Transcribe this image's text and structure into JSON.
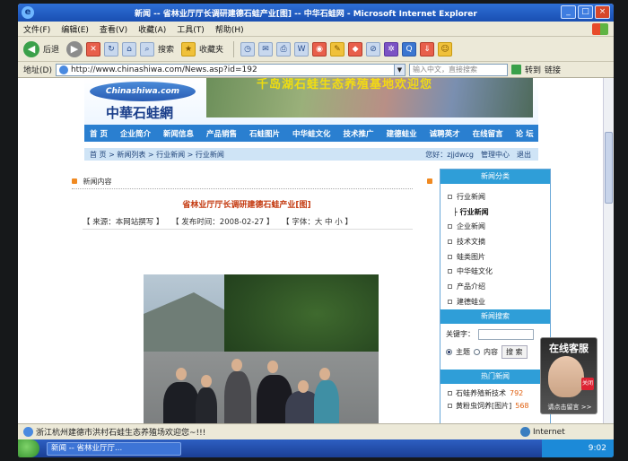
{
  "window": {
    "title": "新闻 -- 省林业厅厅长调研建德石蛙产业[图] -- 中华石蛙网 - Microsoft Internet Explorer",
    "buttons": [
      "_",
      "□",
      "×"
    ]
  },
  "menu": [
    "文件(F)",
    "编辑(E)",
    "查看(V)",
    "收藏(A)",
    "工具(T)",
    "帮助(H)"
  ],
  "toolbar": {
    "back": "后退",
    "search": "搜索",
    "favorites": "收藏夹"
  },
  "address": {
    "label": "地址(D)",
    "url": "http://www.chinashiwa.com/News.asp?id=192",
    "search_placeholder": "输入中文，直接搜索",
    "go": "转到",
    "links": "链接"
  },
  "site": {
    "logo_en": "Chinashiwa.com",
    "logo_cn": "中華石蛙網",
    "banner_slogan": "千岛湖石蛙生态养殖基地欢迎您",
    "nav": [
      "首 页",
      "企业简介",
      "新闻信息",
      "产品销售",
      "石蛙图片",
      "中华蛙文化",
      "技术推广",
      "建德蛙业",
      "诚聘英才",
      "在线留言",
      "论 坛"
    ],
    "breadcrumb": "首 页 > 新闻列表 > 行业新闻 > 行业新闻",
    "user_greeting": "您好：zjjdwcg",
    "user_admin": "管理中心",
    "user_logout": "退出"
  },
  "article": {
    "section": "新闻内容",
    "title": "省林业厅厅长调研建德石蛙产业[图]",
    "source": "【 来源：本网站撰写 】",
    "date": "【 发布时间：2008-02-27 】",
    "font_size": "【 字体：大 中 小 】"
  },
  "sidebar": {
    "categories_title": "新闻分类",
    "categories": [
      {
        "label": "行业新闻",
        "sub": false
      },
      {
        "label": "├ 行业新闻",
        "sub": true
      },
      {
        "label": "企业新闻",
        "sub": false
      },
      {
        "label": "技术文摘",
        "sub": false
      },
      {
        "label": "蛙类图片",
        "sub": false
      },
      {
        "label": "中华蛙文化",
        "sub": false
      },
      {
        "label": "产品介绍",
        "sub": false
      },
      {
        "label": "建德蛙业",
        "sub": false
      }
    ],
    "search_title": "新闻搜索",
    "keyword_label": "关键字：",
    "radio_subject": "主题",
    "radio_content": "内容",
    "search_button": "搜 索",
    "hot_title": "热门新闻",
    "hot": [
      {
        "label": "石蛙养殖新技术",
        "count": "792"
      },
      {
        "label": "黄粉虫饲养[图片]",
        "count": "568"
      }
    ]
  },
  "service": {
    "title": "在线客服",
    "close": "关闭",
    "footer": "请点击留言 >>"
  },
  "status": {
    "text": "浙江杭州建德市洪村石蛙生态养殖场欢迎您~!!!",
    "zone": "Internet"
  },
  "taskbar": {
    "task": "新闻 -- 省林业厅厅...",
    "clock": "9:02"
  }
}
